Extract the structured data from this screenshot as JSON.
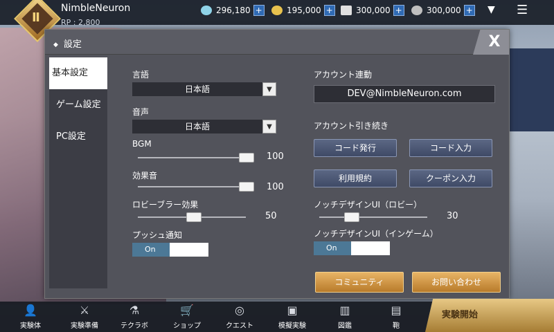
{
  "topbar": {
    "username": "NimbleNeuron",
    "rp": "RP : 2,800",
    "currencies": [
      {
        "icon": "feather-currency-icon",
        "value": "296,180"
      },
      {
        "icon": "coin-currency-icon",
        "value": "195,000"
      },
      {
        "icon": "crystal-currency-icon",
        "value": "300,000"
      },
      {
        "icon": "gear-currency-icon",
        "value": "300,000"
      }
    ]
  },
  "modal": {
    "title": "設定",
    "close_label": "X",
    "sidebar": [
      "基本設定",
      "ゲーム設定",
      "PC設定"
    ],
    "language_label": "言語",
    "language_value": "日本語",
    "voice_label": "音声",
    "voice_value": "日本語",
    "bgm_label": "BGM",
    "bgm_value": "100",
    "sfx_label": "効果音",
    "sfx_value": "100",
    "lobby_blur_label": "ロビーブラー効果",
    "lobby_blur_value": "50",
    "push_label": "プッシュ通知",
    "push_state": "On",
    "account_link_label": "アカウント連動",
    "account_email": "DEV@NimbleNeuron.com",
    "account_transfer_label": "アカウント引き続き",
    "btn_code_issue": "コード発行",
    "btn_code_input": "コード入力",
    "btn_terms": "利用規約",
    "btn_coupon": "クーポン入力",
    "notch_lobby_label": "ノッチデザインUI（ロビー）",
    "notch_lobby_value": "30",
    "notch_ingame_label": "ノッチデザインUI（インゲーム）",
    "notch_ingame_state": "On",
    "btn_community": "コミュニティ",
    "btn_contact": "お問い合わせ"
  },
  "bottom_nav": [
    "実験体",
    "実験準備",
    "テクラボ",
    "ショップ",
    "クエスト",
    "模擬実験",
    "図鑑",
    "鞄"
  ],
  "start_label": "実験開始"
}
